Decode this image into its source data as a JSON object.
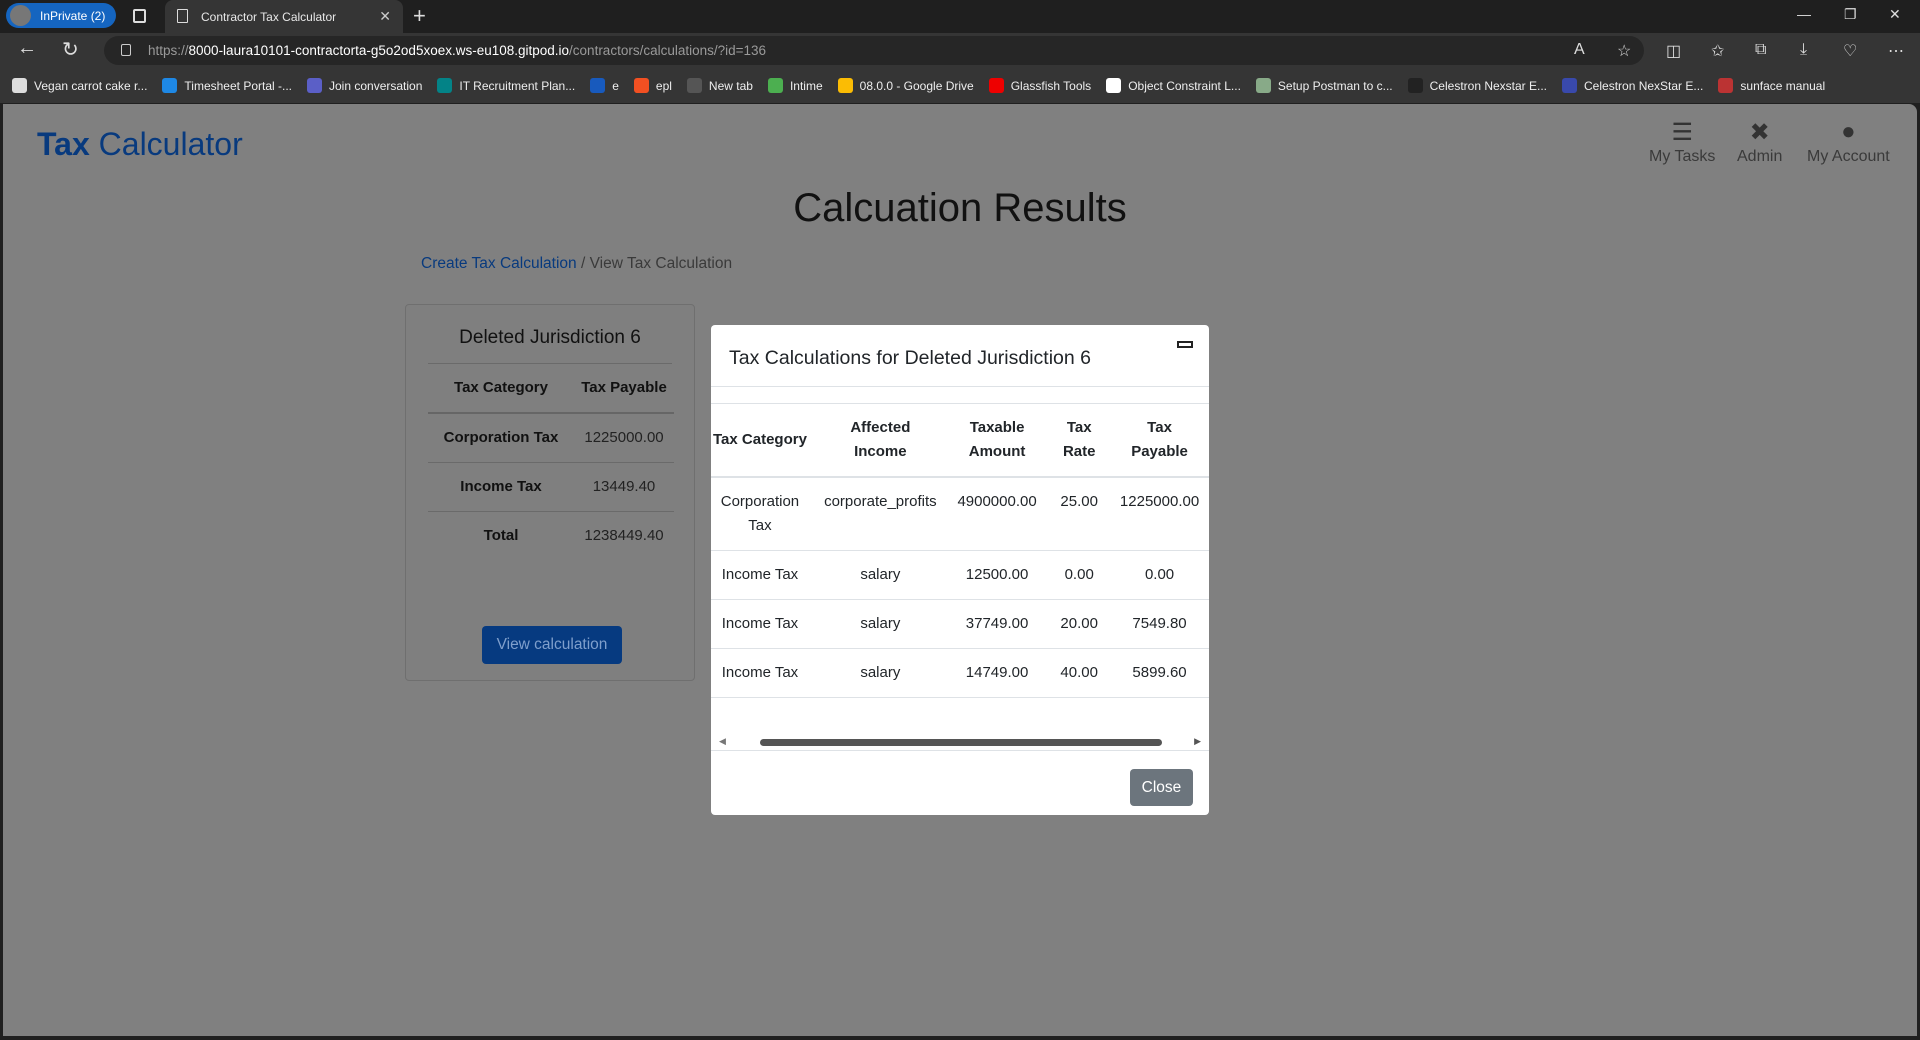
{
  "browser": {
    "inprivate": "InPrivate (2)",
    "tab_title": "Contractor Tax Calculator",
    "url_prefix": "https://",
    "url_host": "8000-laura10101-contractorta-g5o2od5xoex.ws-eu108.gitpod.io",
    "url_path": "/contractors/calculations/?id=136",
    "bookmarks": [
      {
        "label": "Vegan carrot cake r...",
        "color": "#ddd"
      },
      {
        "label": "Timesheet Portal -...",
        "color": "#1e88e5"
      },
      {
        "label": "Join conversation",
        "color": "#5b5fc7"
      },
      {
        "label": "IT Recruitment Plan...",
        "color": "#038387"
      },
      {
        "label": "e",
        "color": "#185abd"
      },
      {
        "label": "epl",
        "color": "#f25022"
      },
      {
        "label": "New tab",
        "color": "#555"
      },
      {
        "label": "Intime",
        "color": "#4caf50"
      },
      {
        "label": "08.0.0 - Google Drive",
        "color": "#fbbc04"
      },
      {
        "label": "Glassfish Tools",
        "color": "#e00"
      },
      {
        "label": "Object Constraint L...",
        "color": "#fff"
      },
      {
        "label": "Setup Postman to c...",
        "color": "#8a8"
      },
      {
        "label": "Celestron Nexstar E...",
        "color": "#222"
      },
      {
        "label": "Celestron NexStar E...",
        "color": "#3949ab"
      },
      {
        "label": "sunface manual",
        "color": "#b33"
      }
    ]
  },
  "header": {
    "brand_bold": "Tax",
    "brand_rest": " Calculator",
    "nav": [
      {
        "label": "My Tasks",
        "icon": "tasks-icon"
      },
      {
        "label": "Admin",
        "icon": "tools-icon"
      },
      {
        "label": "My Account",
        "icon": "user-icon"
      }
    ]
  },
  "page_title": "Calcuation Results",
  "breadcrumb": {
    "link": "Create Tax Calculation",
    "sep": "/",
    "current": "View Tax Calculation"
  },
  "card": {
    "title": "Deleted Jurisdiction 6",
    "headers": [
      "Tax Category",
      "Tax Payable"
    ],
    "rows": [
      [
        "Corporation Tax",
        "1225000.00"
      ],
      [
        "Income Tax",
        "13449.40"
      ],
      [
        "Total",
        "1238449.40"
      ]
    ],
    "button": "View calculation"
  },
  "modal": {
    "title": "Tax Calculations for Deleted Jurisdiction 6",
    "headers": [
      "Tax Category",
      "Affected Income",
      "Taxable Amount",
      "Tax Rate",
      "Tax Payable"
    ],
    "rows": [
      [
        "Corporation Tax",
        "corporate_profits",
        "4900000.00",
        "25.00",
        "1225000.00"
      ],
      [
        "Income Tax",
        "salary",
        "12500.00",
        "0.00",
        "0.00"
      ],
      [
        "Income Tax",
        "salary",
        "37749.00",
        "20.00",
        "7549.80"
      ],
      [
        "Income Tax",
        "salary",
        "14749.00",
        "40.00",
        "5899.60"
      ]
    ],
    "close": "Close"
  }
}
